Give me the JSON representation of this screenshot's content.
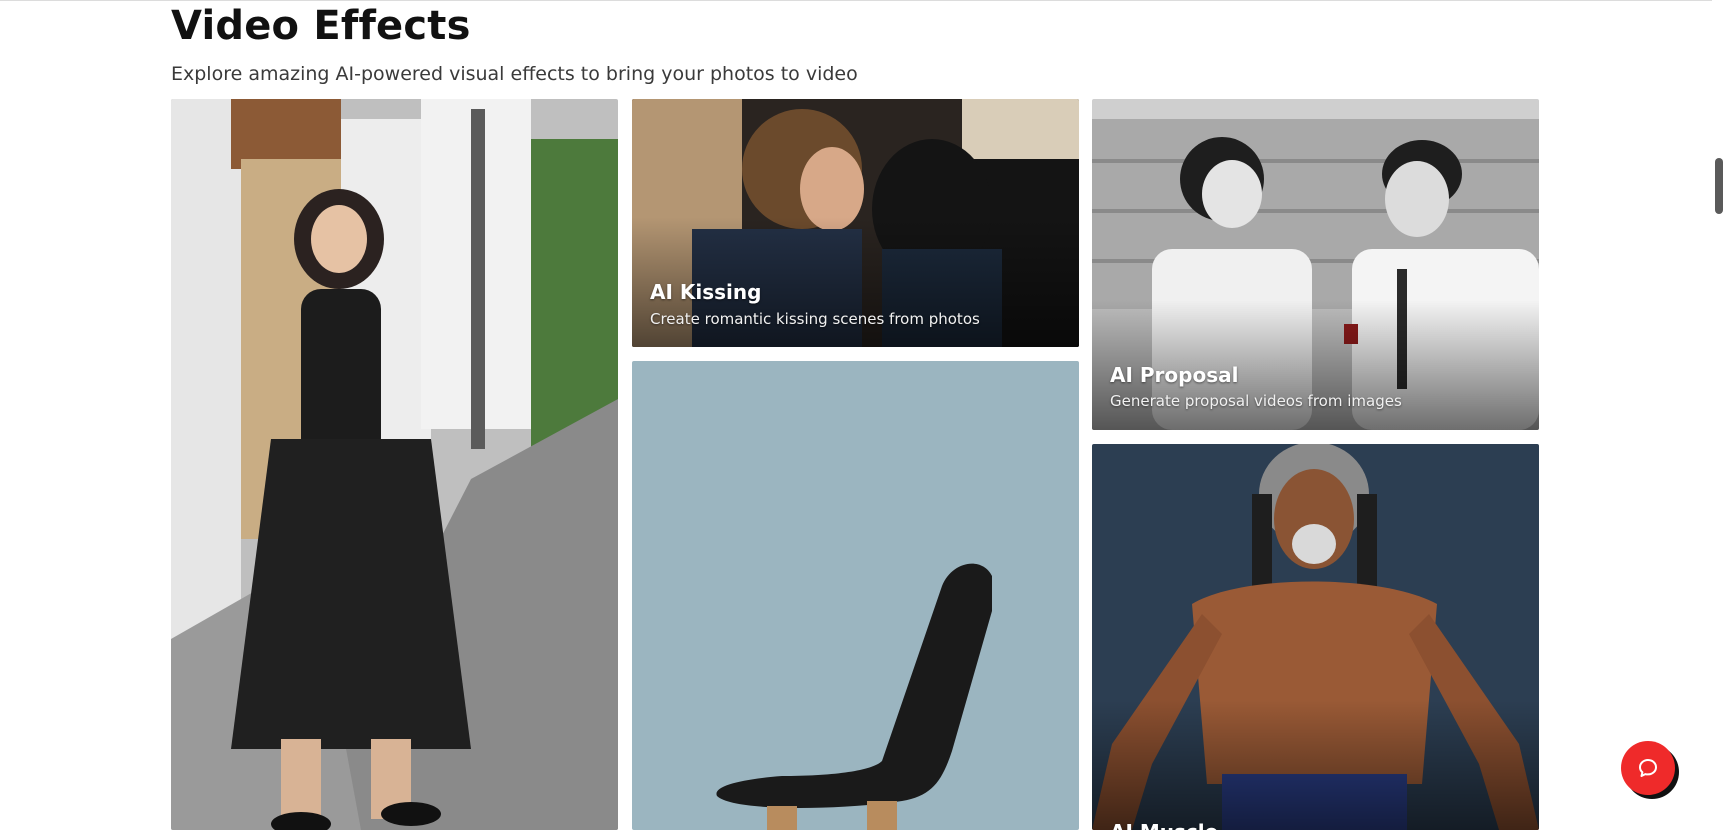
{
  "section": {
    "title": "Video Effects",
    "subtitle": "Explore amazing AI-powered visual effects to bring your photos to video"
  },
  "cards": [
    {
      "name": "walking-woman-effect",
      "title": "",
      "description": ""
    },
    {
      "name": "ai-kissing",
      "title": "AI Kissing",
      "description": "Create romantic kissing scenes from photos"
    },
    {
      "name": "ai-proposal",
      "title": "AI Proposal",
      "description": "Generate proposal videos from images"
    },
    {
      "name": "chair-effect",
      "title": "",
      "description": ""
    },
    {
      "name": "ai-muscle",
      "title": "AI Muscle",
      "description": ""
    }
  ],
  "chat": {
    "icon": "chat-bubble-icon"
  },
  "colors": {
    "accent": "#ef2a2a",
    "text": "#111111",
    "subtext": "#3a3a3a"
  }
}
